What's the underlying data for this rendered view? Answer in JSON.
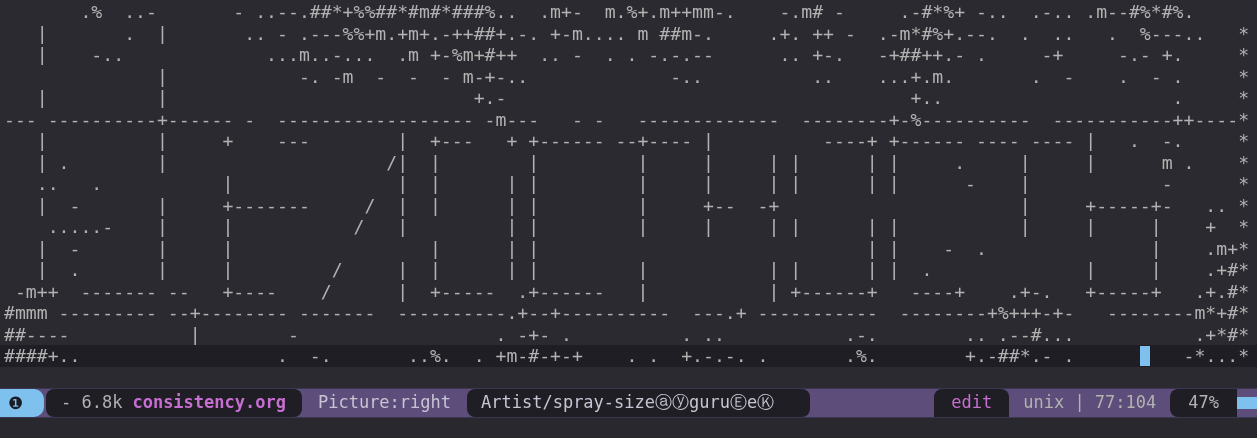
{
  "buffer": {
    "lines": [
      {
        "text": "       .%  ..-       - ..--.##*+%%##*#m#*###%..  .m+-  m.%+.m++mm-.    -.m# -     .-#*%+ -..  .-.. .m--#%*#%.",
        "current": false
      },
      {
        "text": "   |       .  |       .. - .---%%+m.+m+.-++##+.-. +-m.... m ##m-.     .+. ++ -  .-m*#%+.--.  .  ..   .  %---..   *",
        "current": false
      },
      {
        "text": "   |    -..             ...m..-...  .m +-%m+#++  .. -  . . -.-.--      .. +-.   -+##++.- .     -+     -.- +.     *",
        "current": false
      },
      {
        "text": "              |            -. -m  -  -  - m-+-..             -..          ..    ...+.m.       .  -    .  - .     *",
        "current": false
      },
      {
        "text": "   |          |                            +.-                                     +..                     .     *",
        "current": false
      },
      {
        "text": "--- ----------+------ -  ------------------ -m---   - -   -------------  --------+-%----------  -----------++----*",
        "current": false
      },
      {
        "text": "   |          |     +    ---        |  +---   + +------ --+---- |          ----+ +------ ---- ---- |   .  -.     *",
        "current": false
      },
      {
        "text": "   | .        |                    /|  |        |         |     |     | |      | |     .     |     |      m .    *",
        "current": false
      },
      {
        "text": "   ..   .           |               |  |      | |         |     |     | |      | |      -    |            -      *",
        "current": false
      },
      {
        "text": "   |  -       |     +-------     /  |  |      | |         |     +--  -+                      |     +-----+-   .. *",
        "current": false
      },
      {
        "text": "    .....-    |     |           /   |         | |         |     |     | |      | |           |     |     |    +  *",
        "current": false
      },
      {
        "text": "   |  -       |     |                  |      | |                              | |    -  .               |    .m+*",
        "current": false
      },
      {
        "text": "   |  .       |     |         /     |  |      | |         |           | |      | |  .              |     |    .+#*",
        "current": false
      },
      {
        "text": " -m++  ------- --   +----    /      |  +-----  .+------   |           | +------+   ----+    .+-.   +-----+   .+.#*",
        "current": false
      },
      {
        "text": "#mmm --------- --+-------- -------  ----------.+--+----------  ---.+ -----------  --------+%+++-+-   --------m*+#*",
        "current": false
      },
      {
        "text": "##----           |        -                  . -+- .          . ..           .-.        .. .--#...           .+*#*",
        "current": false
      },
      {
        "text": "####+..                  .  -.       ..%.  . +m-#-+-+    . .  +.-.-. .       .%.        +.-##*.- .      ",
        "after_cursor": "   -*...*",
        "current": true
      }
    ]
  },
  "mode_line": {
    "window_number": "❶",
    "size": "- 6.8k",
    "buffer_name": "consistency.org",
    "major_mode": "Picture:right",
    "minor_mode": "Artist/spray-sizeⓐⓨguruⒺeⓀ",
    "state": "edit",
    "encoding_position": "unix | 77:104",
    "percent": "47%"
  }
}
